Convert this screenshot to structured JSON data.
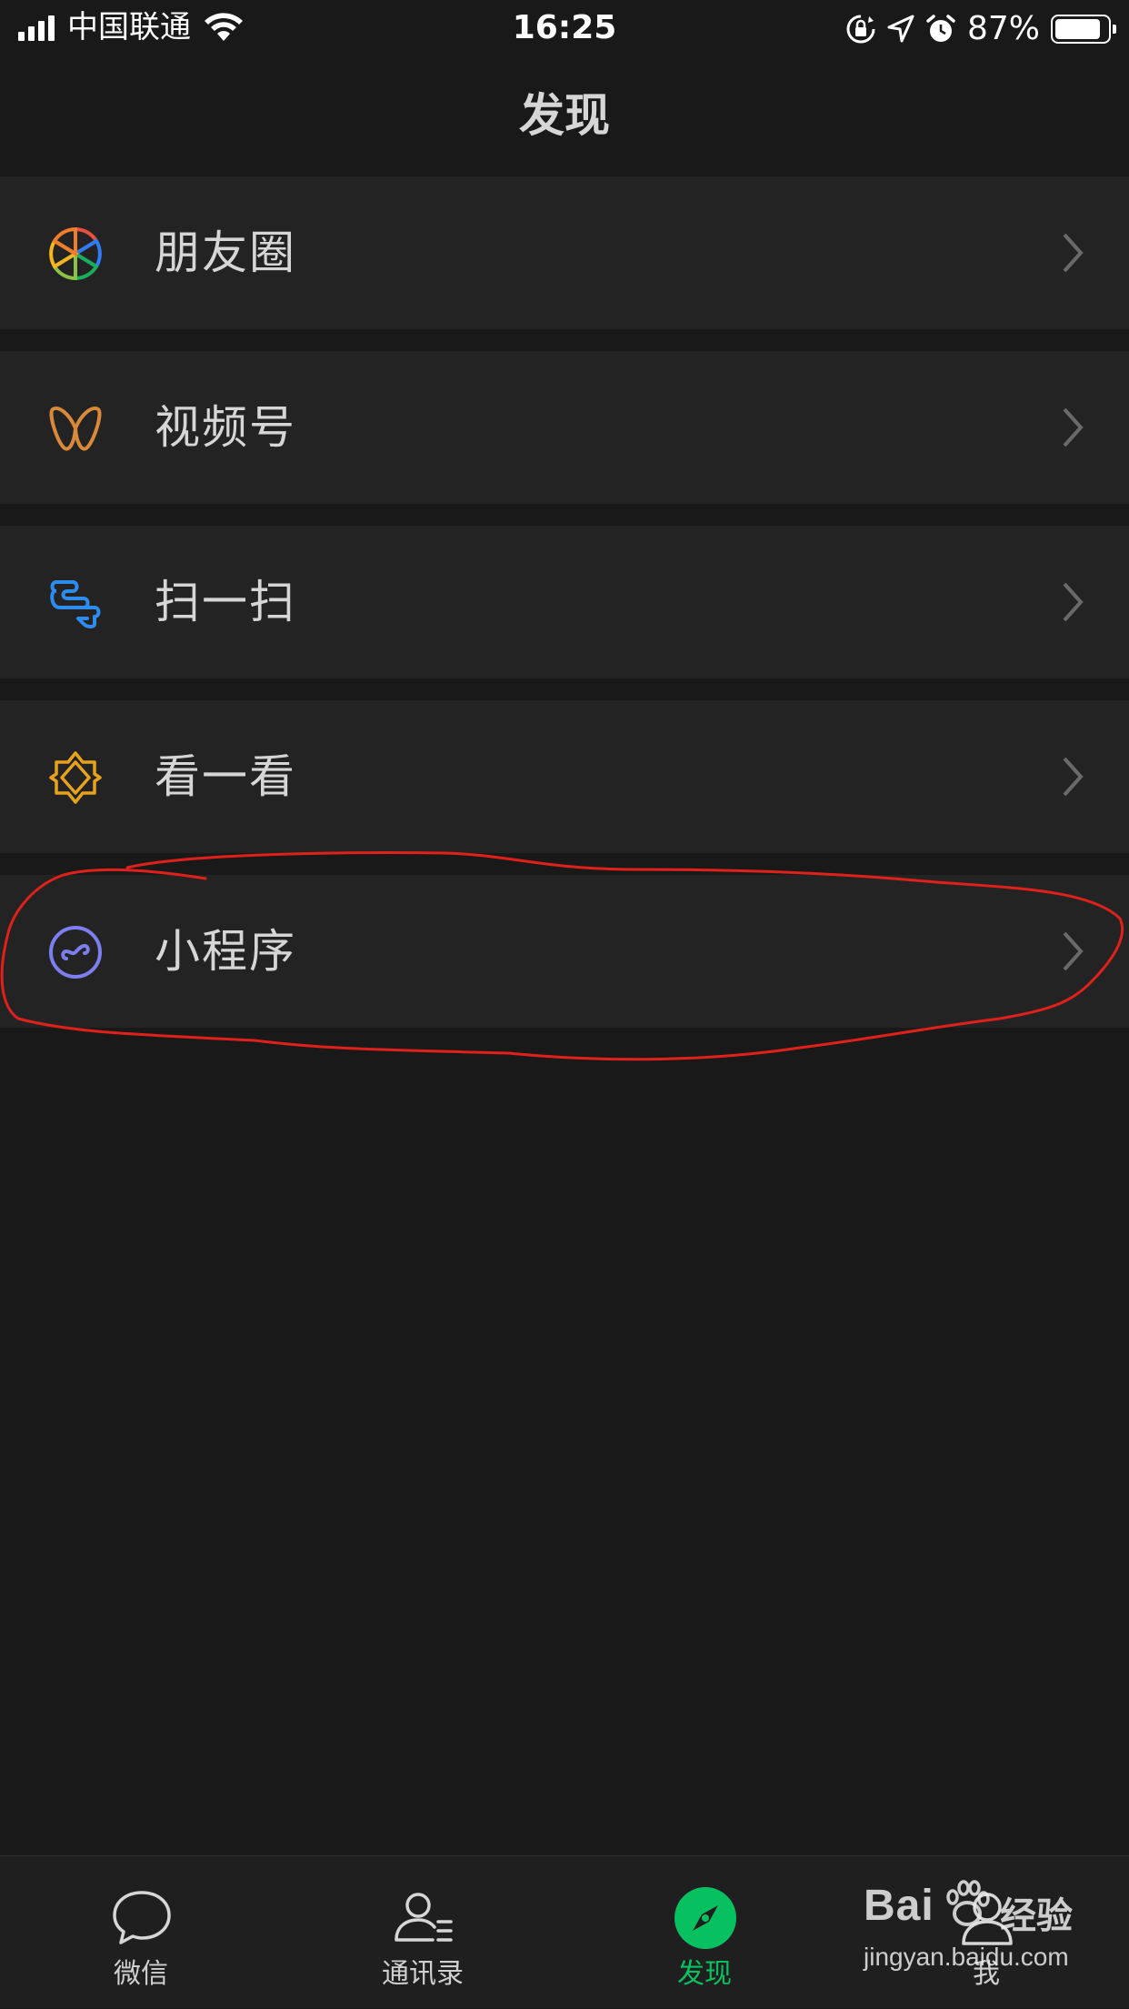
{
  "status_bar": {
    "carrier": "中国联通",
    "time": "16:25",
    "battery_percent": "87%",
    "battery_level": 0.87,
    "icons": [
      "signal-icon",
      "wifi-icon",
      "orientation-lock-icon",
      "location-icon",
      "alarm-icon",
      "battery-icon"
    ]
  },
  "header": {
    "title": "发现"
  },
  "menu": {
    "items": [
      {
        "label": "朋友圈",
        "icon": "moments-icon"
      },
      {
        "label": "视频号",
        "icon": "channels-icon"
      },
      {
        "label": "扫一扫",
        "icon": "scan-icon"
      },
      {
        "label": "看一看",
        "icon": "top-stories-icon"
      },
      {
        "label": "小程序",
        "icon": "mini-programs-icon",
        "annotated": true
      }
    ]
  },
  "tab_bar": {
    "tabs": [
      {
        "label": "微信",
        "icon": "chat-icon"
      },
      {
        "label": "通讯录",
        "icon": "contacts-icon"
      },
      {
        "label": "发现",
        "icon": "discover-icon",
        "active": true
      },
      {
        "label": "我",
        "icon": "me-icon"
      }
    ]
  },
  "watermark": {
    "logo": "Bai",
    "brand": "经验",
    "url": "jingyan.baidu.com"
  },
  "colors": {
    "background": "#191919",
    "cell": "#232323",
    "accent": "#07c160",
    "annotation": "#e0201b"
  }
}
